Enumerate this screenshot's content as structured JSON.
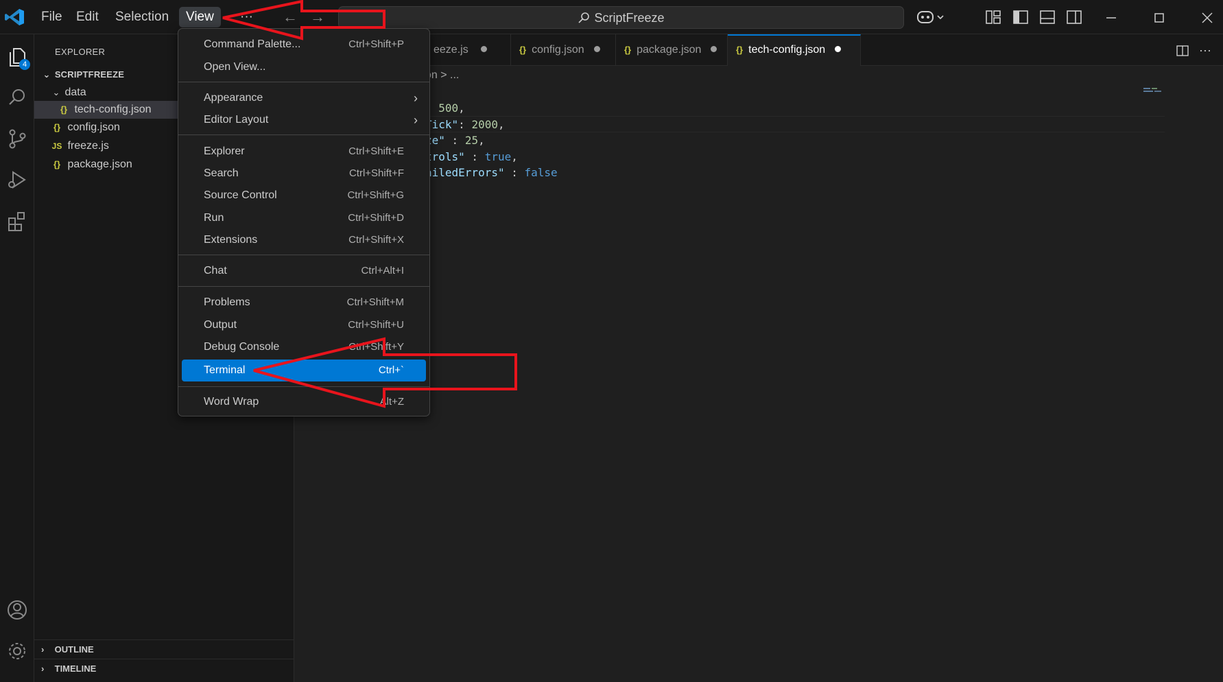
{
  "titlebar": {
    "menu": [
      "File",
      "Edit",
      "Selection",
      "View",
      "···"
    ],
    "nav_back": "←",
    "nav_forward": "→",
    "search_text": "ScriptFreeze"
  },
  "activity_bar": {
    "explorer_badge": "4",
    "icons": [
      "files-icon",
      "search-icon",
      "source-control-icon",
      "run-debug-icon",
      "extensions-icon",
      "account-icon",
      "gear-icon"
    ]
  },
  "sidebar": {
    "title": "EXPLORER",
    "folder": "SCRIPTFREEZE",
    "subfolder": "data",
    "files": [
      {
        "name": "tech-config.json",
        "icon": "{}"
      },
      {
        "name": "config.json",
        "icon": "{}"
      },
      {
        "name": "freeze.js",
        "icon": "JS"
      },
      {
        "name": "package.json",
        "icon": "{}"
      }
    ],
    "outline": "OUTLINE",
    "timeline": "TIMELINE"
  },
  "editor": {
    "tabs": [
      {
        "label": "eeze.js",
        "icon": ""
      },
      {
        "label": "config.json",
        "icon": "{}"
      },
      {
        "label": "package.json",
        "icon": "{}"
      },
      {
        "label": "tech-config.json",
        "icon": "{}"
      }
    ],
    "breadcrumb": "on > ...",
    "code": {
      "l1_num": "500",
      "l2_key": "Tick\"",
      "l2_num": "2000",
      "l3_key": "ze\"",
      "l3_num": "25",
      "l4_key": "trols\"",
      "l4_val": "true",
      "l5_key": "ailedErrors\"",
      "l5_val": "false"
    }
  },
  "view_menu": {
    "items": [
      {
        "label": "Command Palette...",
        "key": "Ctrl+Shift+P"
      },
      {
        "label": "Open View...",
        "key": ""
      },
      {
        "label": "Appearance",
        "key": ""
      },
      {
        "label": "Editor Layout",
        "key": ""
      },
      {
        "label": "Explorer",
        "key": "Ctrl+Shift+E"
      },
      {
        "label": "Search",
        "key": "Ctrl+Shift+F"
      },
      {
        "label": "Source Control",
        "key": "Ctrl+Shift+G"
      },
      {
        "label": "Run",
        "key": "Ctrl+Shift+D"
      },
      {
        "label": "Extensions",
        "key": "Ctrl+Shift+X"
      },
      {
        "label": "Chat",
        "key": "Ctrl+Alt+I"
      },
      {
        "label": "Problems",
        "key": "Ctrl+Shift+M"
      },
      {
        "label": "Output",
        "key": "Ctrl+Shift+U"
      },
      {
        "label": "Debug Console",
        "key": "Ctrl+Shift+Y"
      },
      {
        "label": "Terminal",
        "key": "Ctrl+`"
      },
      {
        "label": "Word Wrap",
        "key": "Alt+Z"
      }
    ]
  },
  "colors": {
    "accent": "#0078d4",
    "annotation": "#e8141c"
  }
}
